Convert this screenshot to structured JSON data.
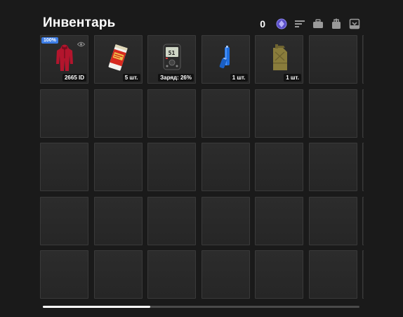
{
  "header": {
    "title": "Инвентарь",
    "coin_count": "0",
    "toolbar_icons": [
      "coin-icon",
      "sort-icon",
      "briefcase-icon",
      "bag-icon",
      "inbox-icon"
    ]
  },
  "inventory": {
    "items": [
      {
        "name": "red-jumpsuit",
        "badge": "100%",
        "quantity": "2665 ID",
        "icon": "jumpsuit"
      },
      {
        "name": "cigarette-pack",
        "quantity": "5 шт.",
        "icon": "cigarettes"
      },
      {
        "name": "charging-device",
        "quantity": "Заряд: 26%",
        "icon": "device",
        "device_display": "51"
      },
      {
        "name": "blue-battery",
        "quantity": "1 шт.",
        "icon": "battery"
      },
      {
        "name": "jerry-can",
        "quantity": "1 шт.",
        "icon": "canister"
      }
    ]
  },
  "scroll": {
    "position": 0.34
  },
  "colors": {
    "accent": "#3d7de6",
    "background": "#1a1a1a",
    "slot": "#2a2a2a"
  }
}
